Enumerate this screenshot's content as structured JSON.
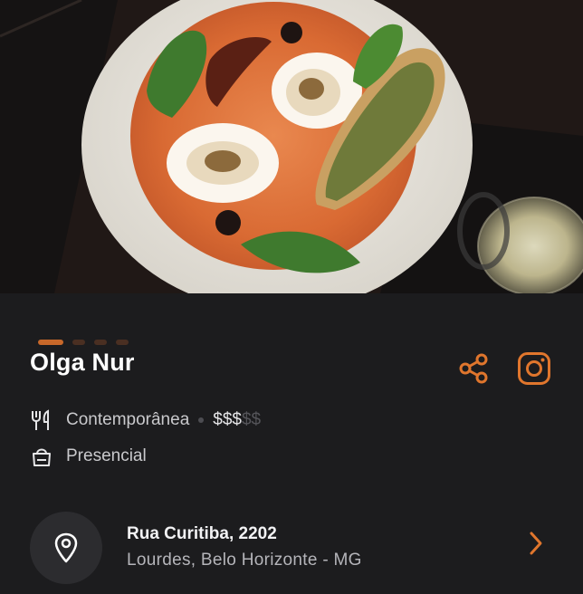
{
  "restaurant": {
    "name": "Olga Nur"
  },
  "carousel": {
    "current_index": 1,
    "count": 4
  },
  "details": {
    "cuisine": "Contemporânea",
    "price_active": "$$$",
    "price_inactive": "$$",
    "service_mode": "Presencial"
  },
  "address": {
    "street": "Rua Curitiba, 2202",
    "area": "Lourdes, Belo Horizonte - MG"
  },
  "icons": {
    "share": "share-icon",
    "instagram": "instagram-icon",
    "cuisine": "fork-knife-icon",
    "service": "shopping-bag-icon",
    "location": "map-pin-icon",
    "chevron": "chevron-right-icon"
  },
  "colors": {
    "accent": "#e0762d",
    "background": "#1c1c1e",
    "card": "#2c2c2f",
    "text_primary": "#ffffff",
    "text_secondary": "#c9c9cc"
  }
}
